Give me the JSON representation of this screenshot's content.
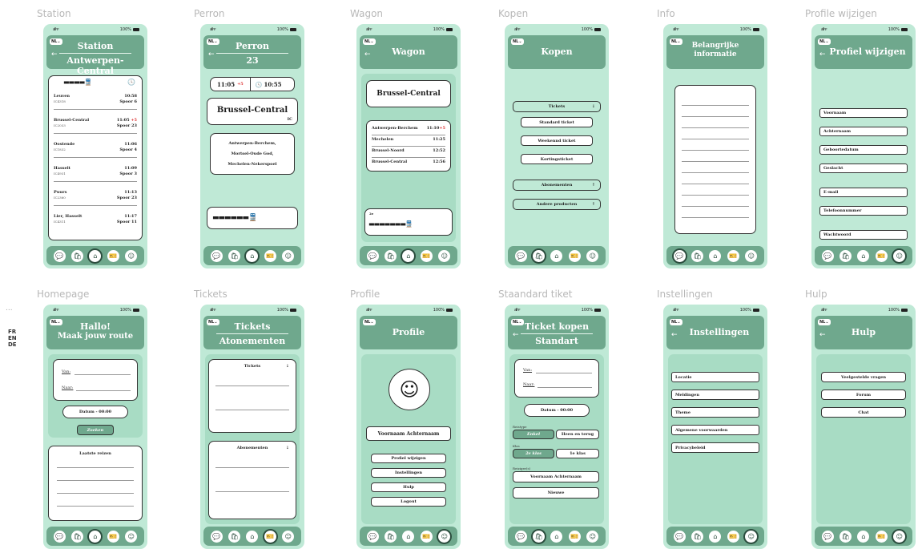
{
  "side": {
    "dots": "...",
    "langs": [
      "FR",
      "EN",
      "DE"
    ]
  },
  "status": {
    "signal": "all ᯤ",
    "battery": "100%"
  },
  "lang_badge": "NL⌄",
  "back_arrow": "←",
  "frames": {
    "station": {
      "title": "Station",
      "header": {
        "line1": "Station",
        "line2": "Antwerpen-Central"
      },
      "train_icons": "▬▬▬▬🚆",
      "clock_icon": "🕓",
      "rows": [
        {
          "dest": "Leuven",
          "time": "10:58",
          "delay": "",
          "code": "IC4318",
          "platform": "Spoor 6"
        },
        {
          "dest": "Brussel-Central",
          "time": "11:05",
          "delay": "+5",
          "code": "IC2033",
          "platform": "Spoor 23"
        },
        {
          "dest": "Oostende",
          "time": "11:06",
          "delay": "",
          "code": "IC1832",
          "platform": "Spoor 4"
        },
        {
          "dest": "Hasselt",
          "time": "11:09",
          "delay": "",
          "code": "IC4931",
          "platform": "Spoor 3"
        },
        {
          "dest": "Puurs",
          "time": "11:13",
          "delay": "",
          "code": "IC2360",
          "platform": "Spoor 23"
        },
        {
          "dest": "Lier, Hasselt",
          "time": "11:17",
          "delay": "",
          "code": "IC4311",
          "platform": "Spoor 11"
        }
      ]
    },
    "perron": {
      "title": "Perron",
      "header": {
        "line1": "Perron",
        "line2": "23"
      },
      "time1": "11:05",
      "delay": "+5",
      "time2": "10:55",
      "clock": "🕓",
      "destination": "Brussel-Central",
      "badge": "IC",
      "via": [
        "Antwerpen-Berchem,",
        "Mortsel-Oude God,",
        "Mechelen-Nekerspoel"
      ],
      "train": "▬▬▬▬▬▬🚆"
    },
    "wagon": {
      "title": "Wagon",
      "header": "Wagon",
      "destination": "Brussel-Central",
      "stops": [
        {
          "name": "Antwerpen-Berchem",
          "time": "11:10",
          "delay": "+5"
        },
        {
          "name": "Mechelen",
          "time": "11:25",
          "delay": ""
        },
        {
          "name": "Brussel-Noord",
          "time": "12:52",
          "delay": ""
        },
        {
          "name": "Brussel-Central",
          "time": "12:56",
          "delay": ""
        }
      ],
      "class_label": "2e",
      "train": "▬▬▬▬▬▬▬🚆"
    },
    "kopen": {
      "title": "Kopen",
      "header": "Kopen",
      "tickets": "Tickets",
      "ticket_options": [
        "Standard ticket",
        "Weekennd ticket",
        "Kortingsticket"
      ],
      "abonnementen": "Abonementen",
      "andere": "Andere producten"
    },
    "info": {
      "title": "Info",
      "header": {
        "line1": "Belangrijke",
        "line2": "informatie"
      }
    },
    "profiel": {
      "title": "Profile wijzigen",
      "header": "Profiel wijzigen",
      "fields": [
        "Voornaam",
        "Achternaam",
        "Geboortedatum",
        "Geslacht",
        "E-mail",
        "Telefoonnummer",
        "Wachtwoord"
      ]
    },
    "home": {
      "title": "Homepage",
      "header": {
        "line1": "Hallo!",
        "line2": "Maak jouw route"
      },
      "van": "Van:",
      "naar": "Naar:",
      "datum": "Datum - 00:00",
      "zoeken": "Zoeken",
      "laatste": "Laatste reizen"
    },
    "tickets": {
      "title": "Tickets",
      "header": {
        "line1": "Tickets",
        "line2": "Atonementen"
      },
      "tickets": "Tickets",
      "abonementen": "Abonementen"
    },
    "profile": {
      "title": "Profile",
      "header": "Profile",
      "name": "Voornaam Achternaam",
      "buttons": [
        "Profiel wijzigen",
        "Instellingen",
        "Hulp",
        "Logout"
      ]
    },
    "standaard": {
      "title": "Staandard tiket",
      "header": {
        "line1": "Ticket kopen",
        "line2": "Standart"
      },
      "van": "Van:",
      "naar": "Naar:",
      "datum": "Datum - 00:00",
      "reistype": "Reistype",
      "enkel": "Enkel",
      "heen": "Heen en terug",
      "klas": "Klas",
      "klas2": "2e klas",
      "klas1": "1e klas",
      "reiziger": "Reiziger(s)",
      "persoon": "Voornaam Achternaam",
      "nieuwe": "Nieuwe"
    },
    "instellingen": {
      "title": "Instellingen",
      "header": "Instellingen",
      "items": [
        "Locatie",
        "Meldingen",
        "Theme",
        "Algemene voorwaarden",
        "Privacybeleid"
      ]
    },
    "hulp": {
      "title": "Hulp",
      "header": "Hulp",
      "items": [
        "Veelgestelde vragen",
        "Forum",
        "Chat"
      ]
    }
  },
  "nav_icons": [
    "💬",
    "🛍",
    "⌂",
    "🎫",
    "☺"
  ]
}
